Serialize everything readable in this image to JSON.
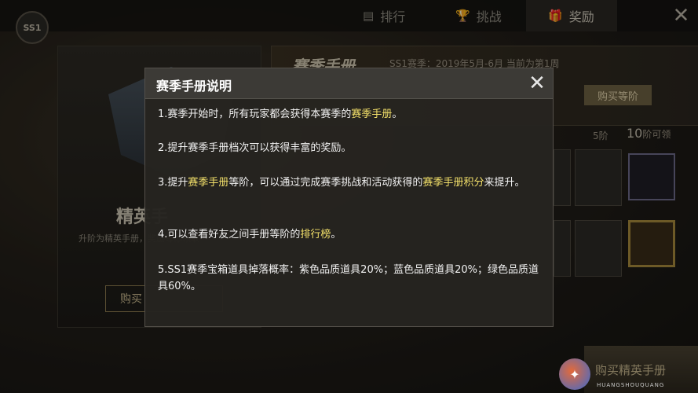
{
  "topbar": {
    "season_badge": "SS1",
    "tabs": [
      {
        "label": "排行",
        "icon": "ranking-icon"
      },
      {
        "label": "挑战",
        "icon": "trophy-icon"
      },
      {
        "label": "奖励",
        "icon": "gift-icon"
      }
    ]
  },
  "background": {
    "elite_title": "精英手",
    "left_desc": "升阶为精英手册，奖励等你领取",
    "left_buy": "购买",
    "manual_title": "赛季手册",
    "season_text": "SS1赛季：2019年5月-6月   当前为第1周",
    "buy_level": "购买等阶",
    "level5": "5阶",
    "level10": "10",
    "level10_suffix": "阶可领",
    "bottom_buy": "购买精英手册"
  },
  "modal": {
    "title": "赛季手册说明",
    "items": [
      {
        "pre": "1.赛季开始时，所有玩家都会获得本赛季的",
        "hl": "赛季手册",
        "post": "。"
      },
      {
        "pre": "2.提升赛季手册档次可以获得丰富的奖励。",
        "hl": "",
        "post": ""
      },
      {
        "pre": "3.提升",
        "hl": "赛季手册",
        "mid": "等阶，可以通过完成赛季挑战和活动获得的",
        "hl2": "赛季手册积分",
        "post": "来提升。"
      },
      {
        "pre": "4.可以查看好友之间手册等阶的",
        "hl": "排行榜",
        "post": "。"
      },
      {
        "pre": "5.SS1赛季宝箱道具掉落概率：紫色品质道具20%；蓝色品质道具20%；绿色品质道具60%。",
        "hl": "",
        "post": ""
      }
    ]
  },
  "watermark": {
    "text": "HUANGSHOUQUANG"
  },
  "colors": {
    "highlight": "#f3e06a",
    "modal_bg": "#262420"
  }
}
